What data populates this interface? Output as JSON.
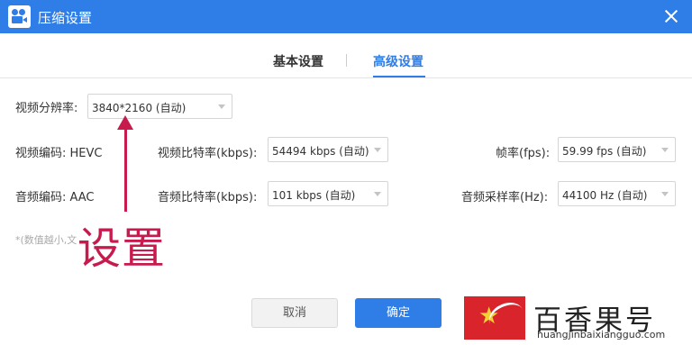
{
  "window": {
    "title": "压缩设置",
    "icon": "camera-app-icon"
  },
  "tabs": [
    {
      "label": "基本设置",
      "active": false
    },
    {
      "label": "高级设置",
      "active": true
    }
  ],
  "video": {
    "resolution_label": "视频分辨率:",
    "resolution_value": "3840*2160 (自动)",
    "codec_label": "视频编码: HEVC",
    "bitrate_label": "视频比特率(kbps):",
    "bitrate_value": "54494 kbps (自动)",
    "fps_label": "帧率(fps):",
    "fps_value": "59.99 fps (自动)"
  },
  "audio": {
    "codec_label": "音频编码: AAC",
    "bitrate_label": "音频比特率(kbps):",
    "bitrate_value": "101 kbps (自动)",
    "samplerate_label": "音频采样率(Hz):",
    "samplerate_value": "44100 Hz (自动)"
  },
  "hint": "*(数值越小,文",
  "annotation": {
    "text": "设置",
    "color": "#c71a4d"
  },
  "buttons": {
    "cancel": "取消",
    "confirm": "确定"
  },
  "watermark": {
    "title": "百香果号",
    "url": "huangjinbaixiangguo.com"
  },
  "colors": {
    "accent": "#2f7de6",
    "annotation": "#c71a4d",
    "watermark_red": "#d9242b"
  }
}
